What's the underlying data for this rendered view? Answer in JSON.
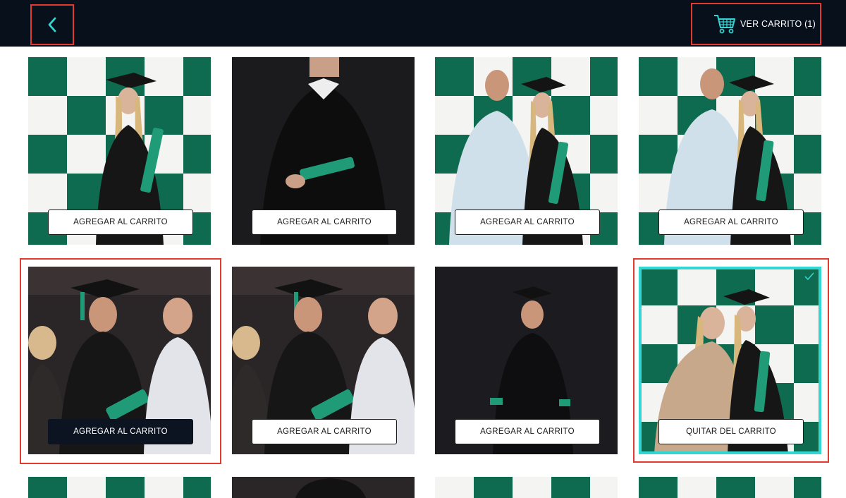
{
  "header": {
    "back_icon": "chevron-left-icon",
    "cart_icon": "shopping-cart-icon",
    "cart_label": "VER CARRITO (1)"
  },
  "colors": {
    "topbar": "#08101c",
    "accent": "#33d6d2",
    "highlight": "#e23a2e",
    "brand_green": "#0f6b4f"
  },
  "gallery": {
    "add_label": "AGREGAR AL CARRITO",
    "remove_label": "QUITAR DEL CARRITO",
    "row1": [
      {
        "button": "AGREGAR AL CARRITO"
      },
      {
        "button": "AGREGAR AL CARRITO"
      },
      {
        "button": "AGREGAR AL CARRITO"
      },
      {
        "button": "AGREGAR AL CARRITO"
      }
    ],
    "row2": [
      {
        "button": "AGREGAR AL CARRITO"
      },
      {
        "button": "AGREGAR AL CARRITO"
      },
      {
        "button": "AGREGAR AL CARRITO"
      },
      {
        "button": "QUITAR DEL CARRITO",
        "in_cart": true
      }
    ]
  }
}
